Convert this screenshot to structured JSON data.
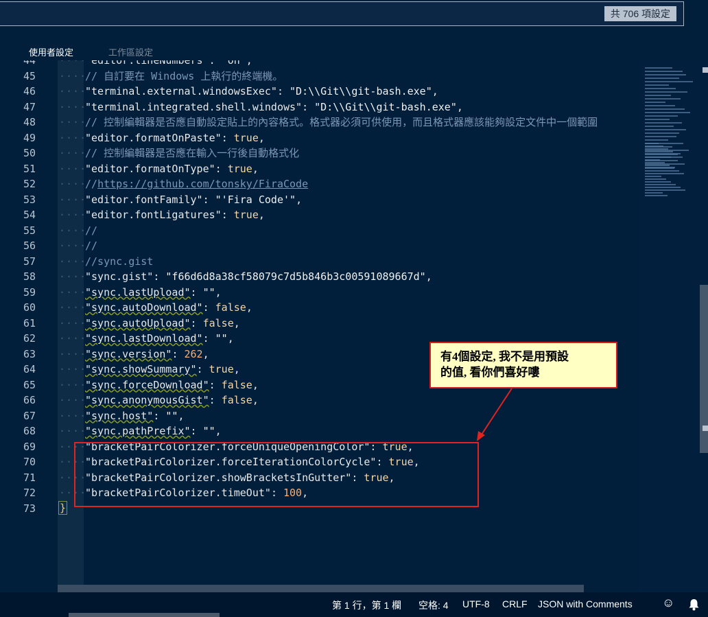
{
  "search": {
    "count_label": "共 706 項設定"
  },
  "tabs": [
    {
      "label": "使用者設定",
      "active": true
    },
    {
      "label": "工作區設定",
      "active": false
    }
  ],
  "editor": {
    "top_partial": {
      "number": "44",
      "text": "\"editor.lineNumbers\": \"on\","
    },
    "lines": [
      {
        "number": "45",
        "parts": [
          {
            "c": "cmt",
            "t": "// 自訂要在 Windows 上執行的終端機。"
          }
        ]
      },
      {
        "number": "46",
        "parts": [
          {
            "c": "key",
            "t": "\"terminal.external.windowsExec\""
          },
          {
            "c": "",
            "t": ": "
          },
          {
            "c": "str",
            "t": "\"D:\\\\Git\\\\git-bash.exe\""
          },
          {
            "c": "",
            "t": ","
          }
        ]
      },
      {
        "number": "47",
        "parts": [
          {
            "c": "key",
            "t": "\"terminal.integrated.shell.windows\""
          },
          {
            "c": "",
            "t": ": "
          },
          {
            "c": "str",
            "t": "\"D:\\\\Git\\\\git-bash.exe\""
          },
          {
            "c": "",
            "t": ","
          }
        ]
      },
      {
        "number": "48",
        "parts": [
          {
            "c": "cmt",
            "t": "// 控制編輯器是否應自動設定貼上的內容格式。格式器必須可供使用，而且格式器應該能夠設定文件中一個範圍"
          }
        ]
      },
      {
        "number": "49",
        "parts": [
          {
            "c": "key",
            "t": "\"editor.formatOnPaste\""
          },
          {
            "c": "",
            "t": ": "
          },
          {
            "c": "val",
            "t": "true"
          },
          {
            "c": "",
            "t": ","
          }
        ]
      },
      {
        "number": "50",
        "parts": [
          {
            "c": "cmt",
            "t": "// 控制編輯器是否應在輸入一行後自動格式化"
          }
        ]
      },
      {
        "number": "51",
        "parts": [
          {
            "c": "key",
            "t": "\"editor.formatOnType\""
          },
          {
            "c": "",
            "t": ": "
          },
          {
            "c": "val",
            "t": "true"
          },
          {
            "c": "",
            "t": ","
          }
        ]
      },
      {
        "number": "52",
        "parts": [
          {
            "c": "cmt",
            "t": "//"
          },
          {
            "c": "link",
            "t": "https://github.com/tonsky/FiraCode"
          }
        ]
      },
      {
        "number": "53",
        "parts": [
          {
            "c": "key",
            "t": "\"editor.fontFamily\""
          },
          {
            "c": "",
            "t": ": "
          },
          {
            "c": "str",
            "t": "\"'Fira Code'\""
          },
          {
            "c": "",
            "t": ","
          }
        ]
      },
      {
        "number": "54",
        "parts": [
          {
            "c": "key",
            "t": "\"editor.fontLigatures\""
          },
          {
            "c": "",
            "t": ": "
          },
          {
            "c": "val",
            "t": "true"
          },
          {
            "c": "",
            "t": ","
          }
        ]
      },
      {
        "number": "55",
        "parts": [
          {
            "c": "cmt",
            "t": "//"
          }
        ]
      },
      {
        "number": "56",
        "parts": [
          {
            "c": "cmt",
            "t": "//"
          }
        ]
      },
      {
        "number": "57",
        "parts": [
          {
            "c": "cmt",
            "t": "//sync.gist"
          }
        ]
      },
      {
        "number": "58",
        "parts": [
          {
            "c": "key",
            "t": "\"sync.gist\""
          },
          {
            "c": "",
            "t": ": "
          },
          {
            "c": "str",
            "t": "\"f66d6d8a38cf58079c7d5b846b3c00591089667d\""
          },
          {
            "c": "",
            "t": ","
          }
        ]
      },
      {
        "number": "59",
        "parts": [
          {
            "c": "key warn",
            "t": "\"sync.lastUpload\""
          },
          {
            "c": "",
            "t": ": "
          },
          {
            "c": "str",
            "t": "\"\""
          },
          {
            "c": "",
            "t": ","
          }
        ]
      },
      {
        "number": "60",
        "parts": [
          {
            "c": "key warn",
            "t": "\"sync.autoDownload\""
          },
          {
            "c": "",
            "t": ": "
          },
          {
            "c": "val",
            "t": "false"
          },
          {
            "c": "",
            "t": ","
          }
        ]
      },
      {
        "number": "61",
        "parts": [
          {
            "c": "key warn",
            "t": "\"sync.autoUpload\""
          },
          {
            "c": "",
            "t": ": "
          },
          {
            "c": "val",
            "t": "false"
          },
          {
            "c": "",
            "t": ","
          }
        ]
      },
      {
        "number": "62",
        "parts": [
          {
            "c": "key warn",
            "t": "\"sync.lastDownload\""
          },
          {
            "c": "",
            "t": ": "
          },
          {
            "c": "str",
            "t": "\"\""
          },
          {
            "c": "",
            "t": ","
          }
        ]
      },
      {
        "number": "63",
        "parts": [
          {
            "c": "key warn",
            "t": "\"sync.version\""
          },
          {
            "c": "",
            "t": ": "
          },
          {
            "c": "num",
            "t": "262"
          },
          {
            "c": "",
            "t": ","
          }
        ]
      },
      {
        "number": "64",
        "parts": [
          {
            "c": "key warn",
            "t": "\"sync.showSummary\""
          },
          {
            "c": "",
            "t": ": "
          },
          {
            "c": "val",
            "t": "true"
          },
          {
            "c": "",
            "t": ","
          }
        ]
      },
      {
        "number": "65",
        "parts": [
          {
            "c": "key warn",
            "t": "\"sync.forceDownload\""
          },
          {
            "c": "",
            "t": ": "
          },
          {
            "c": "val",
            "t": "false"
          },
          {
            "c": "",
            "t": ","
          }
        ]
      },
      {
        "number": "66",
        "parts": [
          {
            "c": "key warn",
            "t": "\"sync.anonymousGist\""
          },
          {
            "c": "",
            "t": ": "
          },
          {
            "c": "val",
            "t": "false"
          },
          {
            "c": "",
            "t": ","
          }
        ]
      },
      {
        "number": "67",
        "parts": [
          {
            "c": "key warn",
            "t": "\"sync.host\""
          },
          {
            "c": "",
            "t": ": "
          },
          {
            "c": "str",
            "t": "\"\""
          },
          {
            "c": "",
            "t": ","
          }
        ]
      },
      {
        "number": "68",
        "parts": [
          {
            "c": "key warn",
            "t": "\"sync.pathPrefix\""
          },
          {
            "c": "",
            "t": ": "
          },
          {
            "c": "str",
            "t": "\"\""
          },
          {
            "c": "",
            "t": ","
          }
        ]
      },
      {
        "number": "69",
        "parts": [
          {
            "c": "key",
            "t": "\"bracketPairColorizer.forceUniqueOpeningColor\""
          },
          {
            "c": "",
            "t": ": "
          },
          {
            "c": "val",
            "t": "true"
          },
          {
            "c": "",
            "t": ","
          }
        ]
      },
      {
        "number": "70",
        "parts": [
          {
            "c": "key",
            "t": "\"bracketPairColorizer.forceIterationColorCycle\""
          },
          {
            "c": "",
            "t": ": "
          },
          {
            "c": "val",
            "t": "true"
          },
          {
            "c": "",
            "t": ","
          }
        ]
      },
      {
        "number": "71",
        "parts": [
          {
            "c": "key",
            "t": "\"bracketPairColorizer.showBracketsInGutter\""
          },
          {
            "c": "",
            "t": ": "
          },
          {
            "c": "val",
            "t": "true"
          },
          {
            "c": "",
            "t": ","
          }
        ]
      },
      {
        "number": "72",
        "parts": [
          {
            "c": "key",
            "t": "\"bracketPairColorizer.timeOut\""
          },
          {
            "c": "",
            "t": ": "
          },
          {
            "c": "num",
            "t": "100"
          },
          {
            "c": "",
            "t": ","
          }
        ]
      }
    ],
    "closing": {
      "number": "73",
      "text": "}"
    }
  },
  "callout": {
    "line1": "有4個設定, 我不是用預設",
    "line2": "的值, 看你們喜好嘍"
  },
  "status": {
    "position": "第 1 行，第 1 欄",
    "indent": "空格: 4",
    "encoding": "UTF-8",
    "eol": "CRLF",
    "language": "JSON with Comments"
  },
  "colors": {
    "accent": "#e0241f",
    "background": "#011e3b",
    "callout_bg": "#ffffc4"
  },
  "icons": {
    "feedback": "smiley-icon",
    "notifications": "bell-icon"
  }
}
